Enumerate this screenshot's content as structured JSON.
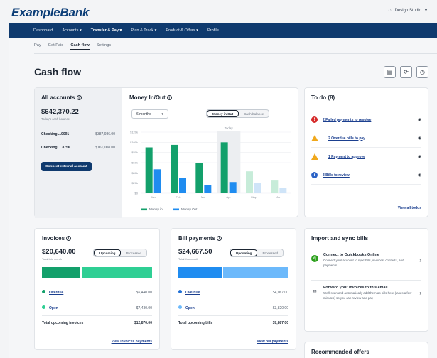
{
  "brand": {
    "logo": "ExampleBank"
  },
  "workspace": {
    "label": "Design Studio"
  },
  "nav": {
    "items": [
      "Dashboard",
      "Accounts",
      "Transfer & Pay",
      "Plan & Track",
      "Product & Offers",
      "Profile"
    ],
    "dropdown_marker": "▾"
  },
  "subtabs": [
    "Pay",
    "Get Paid",
    "Cash flow",
    "Settings"
  ],
  "page": {
    "title": "Cash flow"
  },
  "accounts": {
    "title": "All accounts",
    "total": "$642,370.22",
    "total_sub": "Today's cash balance",
    "rows": [
      {
        "name": "Checking ...0091",
        "value": "$387,986.00"
      },
      {
        "name": "Checking ... 8756",
        "value": "$161,008.00"
      }
    ],
    "connect_label": "Connect external account"
  },
  "money": {
    "title": "Money In/Out",
    "period": "6 months",
    "toggle": [
      "Money in/Out",
      "Cash balance"
    ],
    "today_label": "Today"
  },
  "chart_data": {
    "type": "bar",
    "categories": [
      "Jan",
      "Feb",
      "Mar",
      "Apr",
      "May",
      "Jun"
    ],
    "series": [
      {
        "name": "Money in",
        "values": [
          90,
          95,
          60,
          100,
          43,
          25
        ]
      },
      {
        "name": "Money Out",
        "values": [
          47,
          30,
          16,
          22,
          20,
          10
        ]
      }
    ],
    "y_ticks": [
      "$0",
      "$20k",
      "$40k",
      "$60k",
      "$80k",
      "$100k",
      "$120k"
    ],
    "ylim": [
      0,
      120
    ],
    "projected_from_index": 4,
    "colors": {
      "in": "#13a06b",
      "out": "#1f8cf0",
      "in_projected": "#c7ecd9",
      "out_projected": "#cfe4f8"
    },
    "legend_placement": "bottom-left"
  },
  "todo": {
    "title": "To do (8)",
    "items": [
      {
        "icon": "error-icon",
        "label": "2 Failed payments to resolve"
      },
      {
        "icon": "warning-icon",
        "label": "2 Overdue bills to pay"
      },
      {
        "icon": "warning-icon",
        "label": "1 Payment to approve"
      },
      {
        "icon": "info-icon",
        "label": "3 Bills to review"
      }
    ],
    "view_all": "View all todos"
  },
  "invoices": {
    "title": "Invoices",
    "amount": "$20,640.00",
    "amount_sub": "Total this month",
    "toggle": [
      "Upcoming",
      "Processed"
    ],
    "bar": [
      {
        "fraction": 0.35,
        "color": "#13a06b"
      },
      {
        "fraction": 0.65,
        "color": "#2fcf94"
      }
    ],
    "rows": [
      {
        "label": "Overdue",
        "value": "$5,440.00",
        "color": "#13a06b"
      },
      {
        "label": "Open",
        "value": "$7,430.00",
        "color": "#2fcf94"
      }
    ],
    "total_label": "Total upcoming invoices",
    "total_value": "$12,870.00",
    "view_link": "View invoices payments"
  },
  "bills": {
    "title": "Bill payments",
    "amount": "$24,667.50",
    "amount_sub": "Total this month",
    "toggle": [
      "Upcoming",
      "Processed"
    ],
    "bar": [
      {
        "fraction": 0.4,
        "color": "#1f8cf0"
      },
      {
        "fraction": 0.6,
        "color": "#6cb9fb"
      }
    ],
    "rows": [
      {
        "label": "Overdue",
        "value": "$4,067.00",
        "color": "#1f6fd6"
      },
      {
        "label": "Open",
        "value": "$3,820.00",
        "color": "#6cb9fb"
      }
    ],
    "total_label": "Total upcoming bills",
    "total_value": "$7,887.00",
    "view_link": "View bill payments"
  },
  "import": {
    "title": "Import and sync bills",
    "items": [
      {
        "icon": "quickbooks-icon",
        "title": "Connect to Quickbooks Online",
        "desc": "Connect your account to sync bills, invoices, contacts, and payments."
      },
      {
        "icon": "forward-icon",
        "title": "Forward your invoices to this email",
        "desc": "We'll scan and automatically add them as bills here (takes a few minutes) so you can review and pay"
      }
    ]
  },
  "recommended": {
    "title": "Recommended offers"
  }
}
